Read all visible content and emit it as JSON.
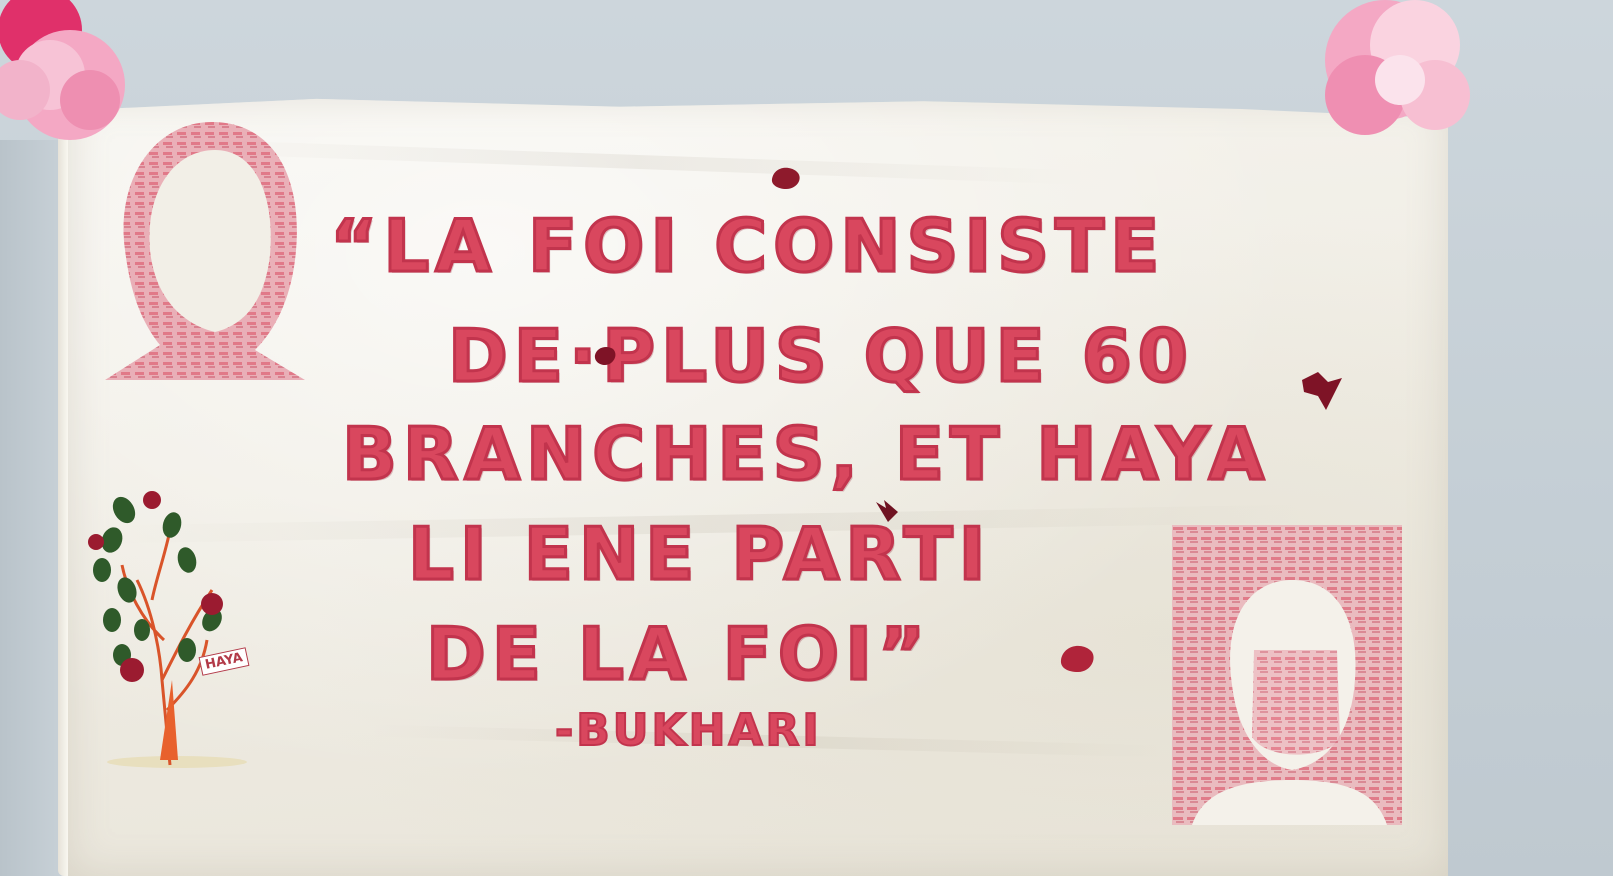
{
  "banner": {
    "quote_lines": [
      "“LA FOI CONSISTE",
      "DE·PLUS QUE 60",
      "BRANCHES, ET HAYA",
      "LI ENE PARTI",
      "DE LA FOI”"
    ],
    "attribution": "-BUKHARI",
    "tree_tag": "HAYA"
  },
  "colors": {
    "ink": "#d9475e",
    "fabric": "#f2efe7",
    "wall": "#c9d3d9",
    "flower_pink": "#f3a6c3",
    "leaf_green": "#2f5a2a",
    "trunk_orange": "#e8612d"
  }
}
